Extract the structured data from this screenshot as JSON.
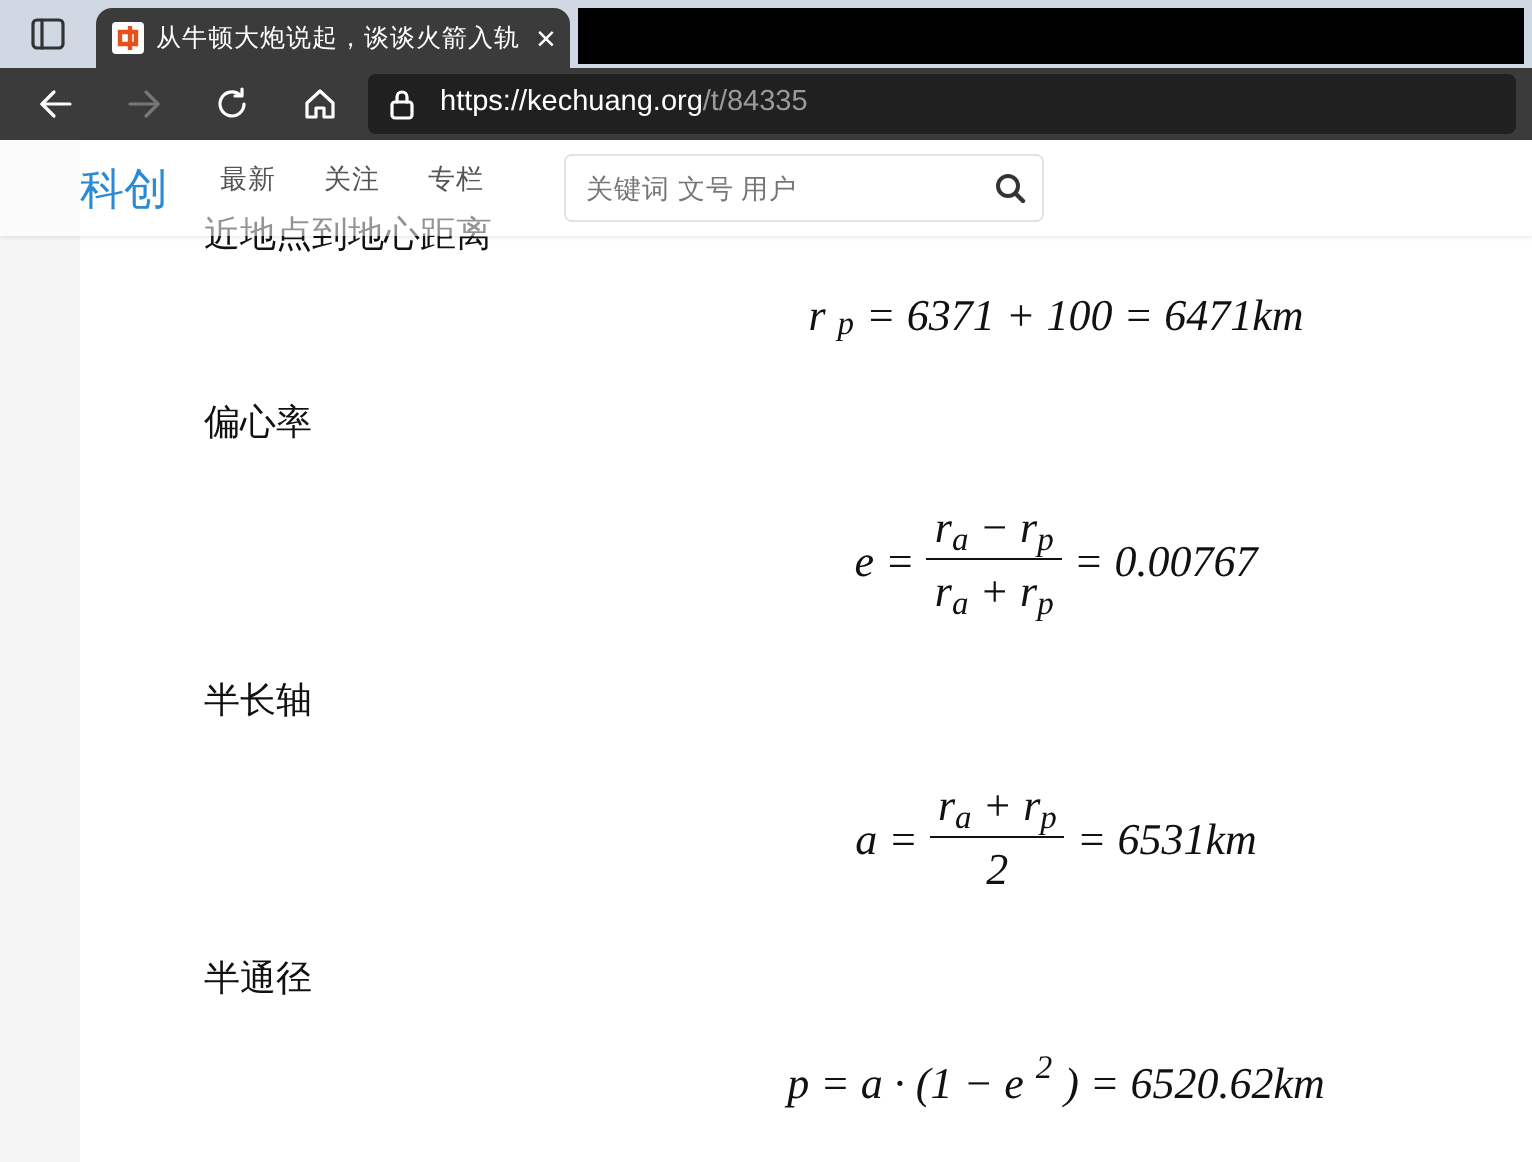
{
  "browser": {
    "tab": {
      "title": "从牛顿大炮说起，谈谈火箭入轨",
      "close": "×",
      "selected": true
    },
    "nav": {
      "back_disabled": false,
      "forward_disabled": true
    },
    "url": {
      "scheme": "https://",
      "host": "kechuang.org",
      "path": "/t/84335"
    }
  },
  "site_header": {
    "logo": "科创",
    "links": [
      "最新",
      "关注",
      "专栏"
    ],
    "search": {
      "placeholder": "关键词 文号 用户"
    }
  },
  "content": [
    {
      "kind": "paragraph",
      "text": "近地点到地心距离"
    },
    {
      "kind": "equation",
      "expr": "r$_{p}$ = 6371 + 100 = 6471km"
    },
    {
      "kind": "paragraph",
      "text": "偏心率"
    },
    {
      "kind": "fraction",
      "lhs": "e =",
      "numerator": "r$_{a}$ − r$_{p}$",
      "denominator": "r$_{a}$ + r$_{p}$",
      "rhs": "= 0.00767"
    },
    {
      "kind": "paragraph",
      "text": "半长轴"
    },
    {
      "kind": "fraction",
      "lhs": "a =",
      "numerator": "r$_{a}$ + r$_{p}$",
      "denominator": "2",
      "rhs": "= 6531km"
    },
    {
      "kind": "paragraph",
      "text": "半通径"
    },
    {
      "kind": "equation",
      "expr": "p = a · (1 − e$^{2}$) = 6520.62km"
    }
  ]
}
